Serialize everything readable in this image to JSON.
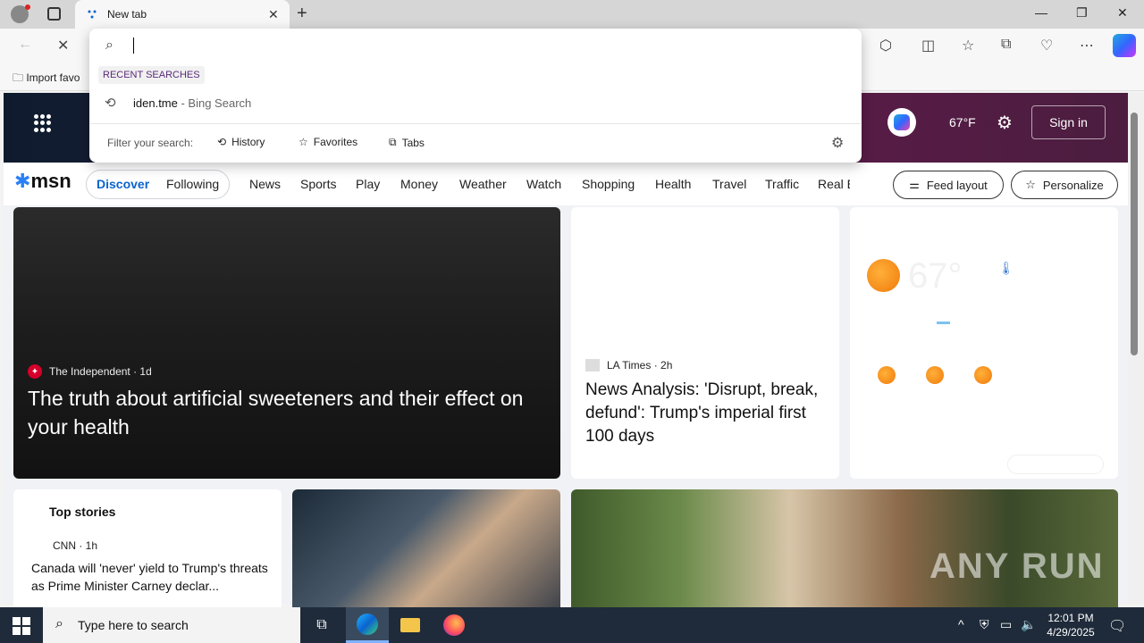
{
  "browser": {
    "tab_title": "New tab",
    "new_tab_symbol": "+",
    "favorites_bar_item": "Import favo"
  },
  "omnibox": {
    "recent_label": "RECENT SEARCHES",
    "recent_query": "iden.tme",
    "recent_suffix": " - Bing Search",
    "filter_label": "Filter your search:",
    "filters": [
      "History",
      "Favorites",
      "Tabs"
    ]
  },
  "msn": {
    "logo": "msn",
    "temperature_top": "67°F",
    "signin": "Sign in",
    "tabs": {
      "discover": "Discover",
      "following": "Following"
    },
    "categories": [
      "News",
      "Sports",
      "Play",
      "Money",
      "Weather",
      "Watch",
      "Shopping",
      "Health",
      "Travel",
      "Traffic",
      "Real E"
    ],
    "feed_layout": "Feed layout",
    "personalize": "Personalize",
    "hero": {
      "source": "The Independent",
      "age": "1d",
      "title": "The truth about artificial sweeteners and their effect on your health"
    },
    "la_card": {
      "source": "LA Times",
      "age": "2h",
      "title": "News Analysis: 'Disrupt, break, defund': Trump's imperial first 100 days"
    },
    "weather_card": {
      "temp": "67°"
    },
    "top_stories": {
      "title": "Top stories",
      "source": "CNN",
      "age": "1h",
      "headline": "Canada will 'never' yield to Trump's threats as Prime Minister Carney declar..."
    },
    "watermark": "ANY RUN"
  },
  "taskbar": {
    "search_placeholder": "Type here to search",
    "time": "12:01 PM",
    "date": "4/29/2025"
  },
  "colors": {
    "accent": "#0b63ce",
    "taskbar": "#1f2b3a"
  }
}
